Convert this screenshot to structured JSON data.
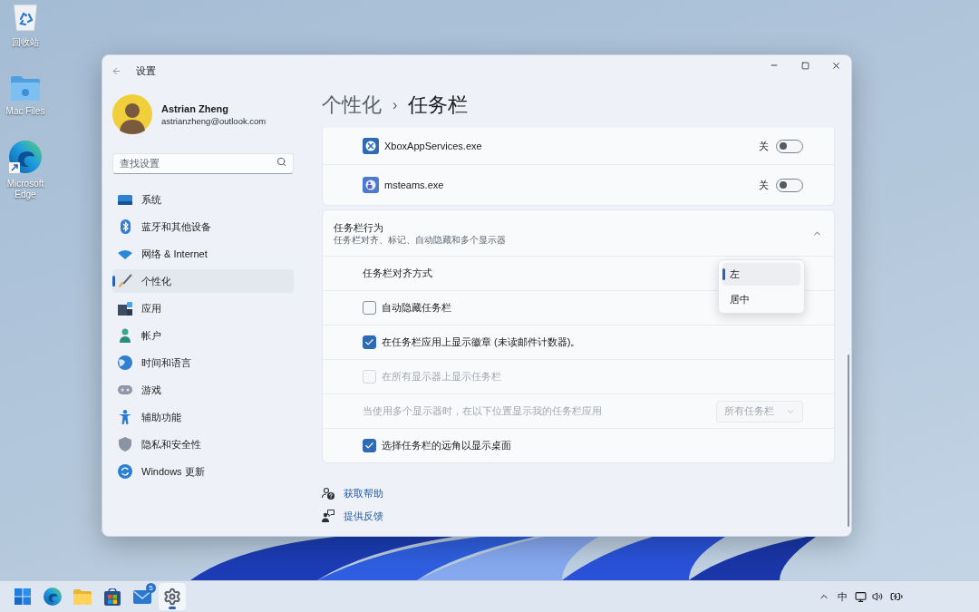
{
  "desktop_icons": [
    {
      "kind": "recycle-bin",
      "label": "回收站"
    },
    {
      "kind": "folder",
      "label": "Mac Files"
    },
    {
      "kind": "edge",
      "label": "Microsoft Edge"
    }
  ],
  "window": {
    "title": "设置"
  },
  "account": {
    "name": "Astrian Zheng",
    "email": "astrianzheng@outlook.com"
  },
  "search": {
    "placeholder": "查找设置"
  },
  "sidebar": {
    "items": [
      {
        "kind": "system",
        "label": "系统",
        "selected": false
      },
      {
        "kind": "bluetooth",
        "label": "蓝牙和其他设备",
        "selected": false
      },
      {
        "kind": "network",
        "label": "网络 & Internet",
        "selected": false
      },
      {
        "kind": "personalization",
        "label": "个性化",
        "selected": true
      },
      {
        "kind": "apps",
        "label": "应用",
        "selected": false
      },
      {
        "kind": "accounts",
        "label": "帐户",
        "selected": false
      },
      {
        "kind": "time",
        "label": "时间和语言",
        "selected": false
      },
      {
        "kind": "gaming",
        "label": "游戏",
        "selected": false
      },
      {
        "kind": "accessibility",
        "label": "辅助功能",
        "selected": false
      },
      {
        "kind": "privacy",
        "label": "隐私和安全性",
        "selected": false
      },
      {
        "kind": "update",
        "label": "Windows 更新",
        "selected": false
      }
    ]
  },
  "breadcrumb": {
    "parent": "个性化",
    "separator": "›",
    "current": "任务栏"
  },
  "app_rows": [
    {
      "kind": "xbox",
      "name": "XboxAppServices.exe",
      "state_label": "关",
      "on": false
    },
    {
      "kind": "teams",
      "name": "msteams.exe",
      "state_label": "关",
      "on": false
    }
  ],
  "behavior": {
    "title": "任务栏行为",
    "subtitle": "任务栏对齐、标记、自动隐藏和多个显示器",
    "expanded": true,
    "rows": [
      {
        "kind": "label",
        "label": "任务栏对齐方式"
      },
      {
        "kind": "checkbox",
        "label": "自动隐藏任务栏",
        "checked": false,
        "disabled": false
      },
      {
        "kind": "checkbox",
        "label": "在任务栏应用上显示徽章 (未读邮件计数器)。",
        "checked": true,
        "disabled": false
      },
      {
        "kind": "checkbox",
        "label": "在所有显示器上显示任务栏",
        "checked": false,
        "disabled": true
      },
      {
        "kind": "select",
        "label": "当使用多个显示器时，在以下位置显示我的任务栏应用",
        "value": "所有任务栏",
        "disabled": true
      },
      {
        "kind": "checkbox",
        "label": "选择任务栏的远角以显示桌面",
        "checked": true,
        "disabled": false
      }
    ]
  },
  "alignment_menu": {
    "options": [
      {
        "label": "左",
        "selected": true
      },
      {
        "label": "居中",
        "selected": false
      }
    ]
  },
  "links": [
    {
      "kind": "help",
      "label": "获取帮助"
    },
    {
      "kind": "feedback",
      "label": "提供反馈"
    }
  ],
  "taskbar": {
    "apps": [
      {
        "kind": "start",
        "selected": false
      },
      {
        "kind": "edge",
        "selected": false
      },
      {
        "kind": "explorer",
        "selected": false
      },
      {
        "kind": "store",
        "selected": false
      },
      {
        "kind": "mail",
        "selected": false,
        "badge": "5"
      },
      {
        "kind": "settings",
        "selected": true
      }
    ],
    "ime": "中"
  }
}
